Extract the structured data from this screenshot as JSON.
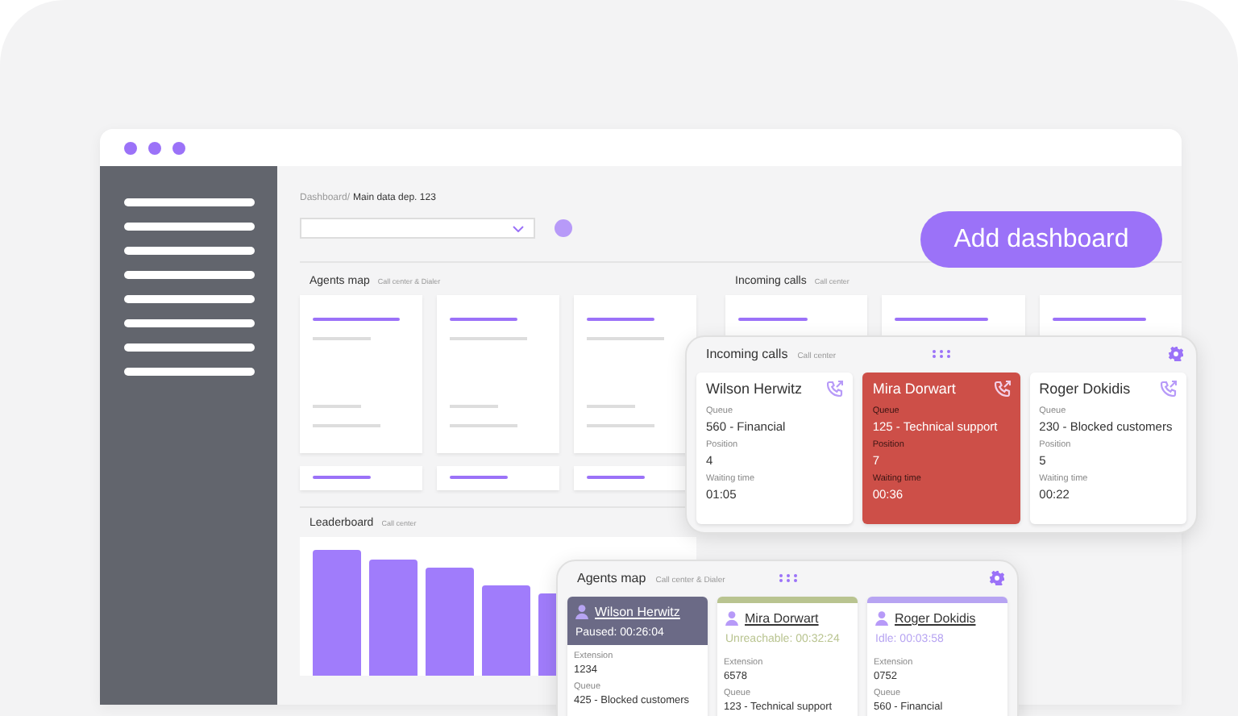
{
  "breadcrumb": {
    "parent": "Dashboard/",
    "current": "Main data dep. 123"
  },
  "add_button": {
    "label": "Add dashboard"
  },
  "background_widgets": [
    {
      "title": "Agents map",
      "subtitle": "Call center & Dialer"
    },
    {
      "title": "Incoming calls",
      "subtitle": "Call center"
    },
    {
      "title": "Leaderboard",
      "subtitle": "Call center"
    }
  ],
  "incoming_calls": {
    "title": "Incoming calls",
    "subtitle": "Call center",
    "calls": [
      {
        "name": "Wilson Herwitz",
        "highlighted": false,
        "fields": [
          {
            "label": "Queue",
            "value": "560 - Financial"
          },
          {
            "label": "Position",
            "value": "4"
          },
          {
            "label": "Waiting time",
            "value": "01:05"
          }
        ]
      },
      {
        "name": "Mira Dorwart",
        "highlighted": true,
        "fields": [
          {
            "label": "Queue",
            "value": "125 - Technical support"
          },
          {
            "label": "Position",
            "value": "7"
          },
          {
            "label": "Waiting time",
            "value": "00:36"
          }
        ]
      },
      {
        "name": "Roger Dokidis",
        "highlighted": false,
        "fields": [
          {
            "label": "Queue",
            "value": "230 - Blocked customers"
          },
          {
            "label": "Position",
            "value": "5"
          },
          {
            "label": "Waiting time",
            "value": "00:22"
          }
        ]
      }
    ]
  },
  "agents_map": {
    "title": "Agents map",
    "subtitle": "Call center & Dialer",
    "agents": [
      {
        "name": "Wilson Herwitz",
        "status": "Paused: 00:26:04",
        "kind": "filled",
        "color": "#6b6a86",
        "fields": [
          {
            "label": "Extension",
            "value": "1234"
          },
          {
            "label": "Queue",
            "value": "425 - Blocked customers"
          }
        ]
      },
      {
        "name": "Mira Dorwart",
        "status": "Unreachable: 00:32:24",
        "kind": "stripe",
        "color": "#b9c490",
        "fields": [
          {
            "label": "Extension",
            "value": "6578"
          },
          {
            "label": "Queue",
            "value": "123 - Technical support"
          }
        ]
      },
      {
        "name": "Roger Dokidis",
        "status": "Idle: 00:03:58",
        "kind": "stripe",
        "color": "#b7a4f2",
        "fields": [
          {
            "label": "Extension",
            "value": "0752"
          },
          {
            "label": "Queue",
            "value": "560 - Financial"
          }
        ]
      }
    ]
  }
}
